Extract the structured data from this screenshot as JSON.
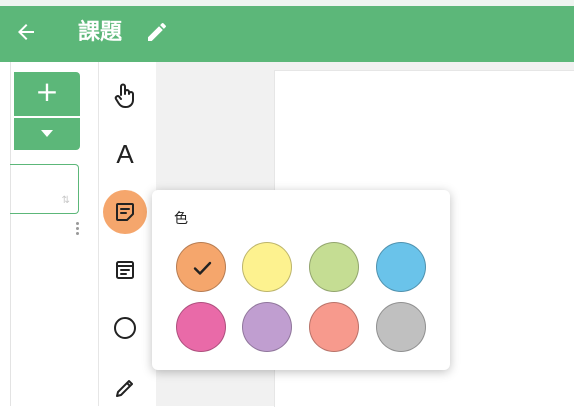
{
  "header": {
    "title": "課題",
    "back_icon": "arrow-left-icon",
    "edit_icon": "pencil-icon",
    "bg_color": "#5cb779"
  },
  "left_panel": {
    "add_label": "+",
    "sort_icon": "sort-arrows-icon"
  },
  "toolbar": {
    "tools": [
      {
        "name": "pointer",
        "icon": "hand-pointer-icon"
      },
      {
        "name": "text",
        "icon": "text-icon",
        "label": "A"
      },
      {
        "name": "sticky-note",
        "icon": "sticky-note-icon",
        "active": true
      },
      {
        "name": "card",
        "icon": "card-icon"
      },
      {
        "name": "circle",
        "icon": "circle-icon"
      },
      {
        "name": "pen",
        "icon": "pen-icon"
      }
    ]
  },
  "color_popup": {
    "label": "色",
    "selected_index": 0,
    "colors": [
      "#f5a66c",
      "#fdf28f",
      "#c5dd93",
      "#6ac3ea",
      "#e96aa8",
      "#c09ed0",
      "#f79a8d",
      "#c0c0c0"
    ]
  }
}
